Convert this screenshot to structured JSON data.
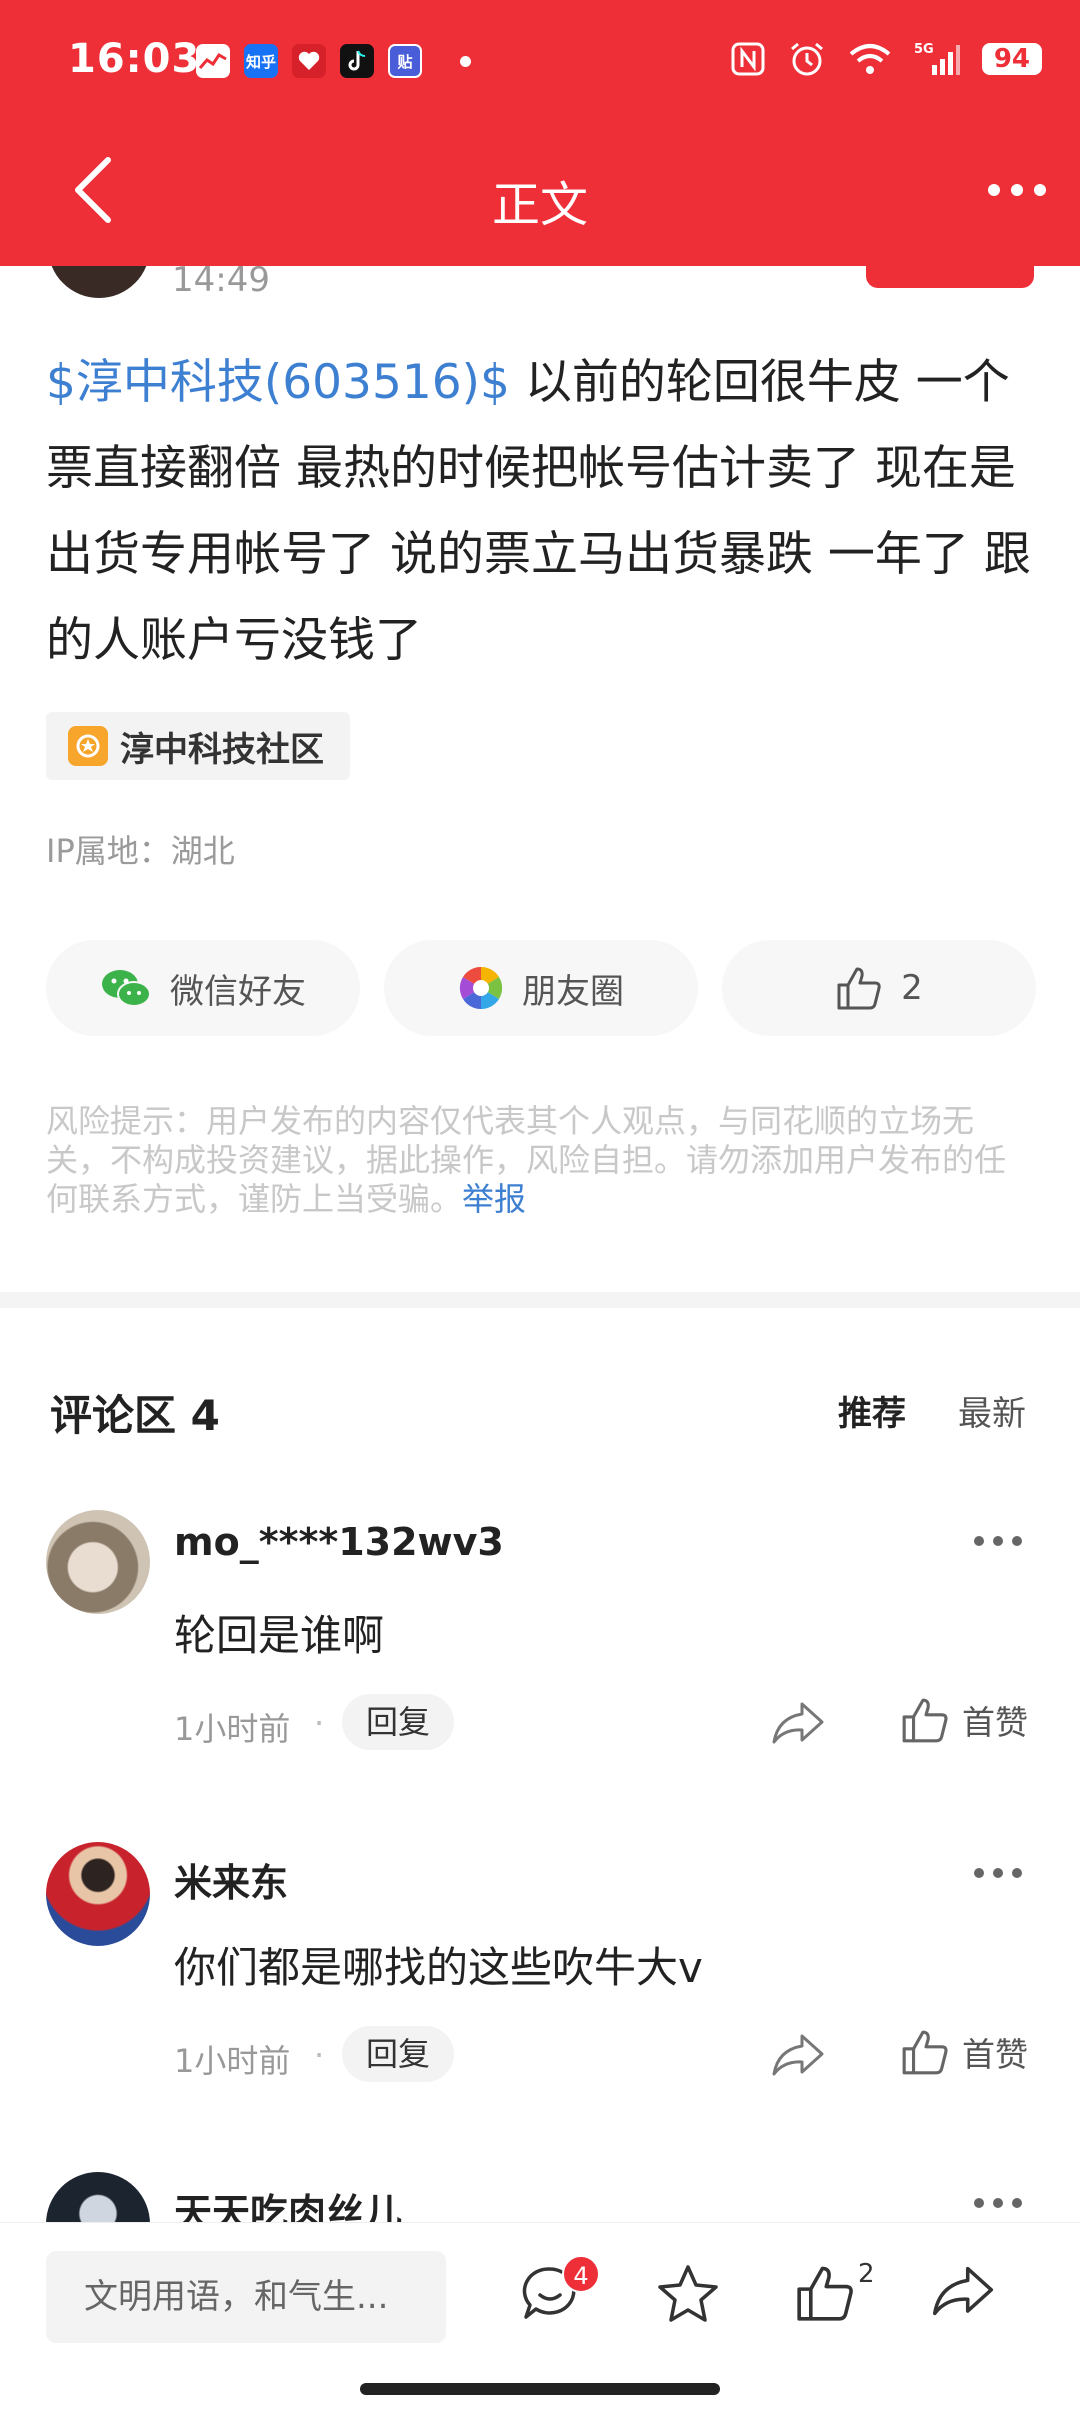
{
  "status_bar": {
    "time": "16:03",
    "battery": "94",
    "app_icons": [
      "stock-app-icon",
      "zhihu-icon",
      "heart-app-icon",
      "tiktok-icon",
      "tieba-icon"
    ],
    "zhihu_label": "知乎",
    "tieba_label": "贴",
    "icons": [
      "nfc-icon",
      "alarm-icon",
      "wifi-icon",
      "signal-5g-icon",
      "battery-icon"
    ]
  },
  "nav": {
    "title": "正文",
    "back_icon": "chevron-left-icon",
    "more_icon": "more-horizontal-icon"
  },
  "post": {
    "time": "14:49",
    "stock_tag": "$淳中科技(603516)$",
    "text": " 以前的轮回很牛皮 一个票直接翻倍 最热的时候把帐号估计卖了 现在是出货专用帐号了 说的票立马出货暴跌 一年了 跟的人账户亏没钱了",
    "topic": "淳中科技社区",
    "ip_location": "IP属地：湖北"
  },
  "share": {
    "wechat_label": "微信好友",
    "moments_label": "朋友圈",
    "like_count": "2"
  },
  "risk": {
    "text": "风险提示：用户发布的内容仅代表其个人观点，与同花顺的立场无关，不构成投资建议，据此操作，风险自担。请勿添加用户发布的任何联系方式，谨防上当受骗。",
    "report_label": "举报"
  },
  "comments_section": {
    "title": "评论区 4",
    "sort_recommended": "推荐",
    "sort_latest": "最新",
    "items": [
      {
        "user": "mo_****132wv3",
        "text": "轮回是谁啊",
        "time": "1小时前",
        "separator": "·",
        "reply_label": "回复",
        "like_label": "首赞"
      },
      {
        "user": "米来东",
        "text": "你们都是哪找的这些吹牛大v",
        "time": "1小时前",
        "separator": "·",
        "reply_label": "回复",
        "like_label": "首赞"
      },
      {
        "user": "天天吃肉丝儿"
      }
    ]
  },
  "bottom_bar": {
    "input_placeholder": "文明用语，和气生...",
    "comment_badge": "4",
    "like_count": "2"
  },
  "colors": {
    "brand_red": "#ee2f38",
    "link_blue": "#3d7fd1",
    "wechat_green": "#3cb34a",
    "topic_orange": "#f7a52b"
  }
}
